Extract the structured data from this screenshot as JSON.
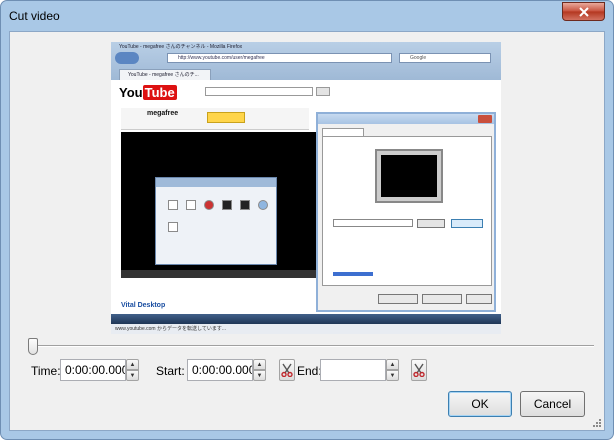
{
  "window": {
    "title": "Cut video"
  },
  "video_preview": {
    "browser_title": "YouTube - megafree さんのチャンネル - Mozilla Firefox",
    "url": "http://www.youtube.com/user/megafree",
    "search_placeholder": "Google",
    "tab_label": "YouTube - megafree さんのチ...",
    "logo_you": "You",
    "logo_tube": "Tube",
    "channel_name": "megafree",
    "video_title": "Vital Desktop",
    "status_text": "www.youtube.com からデータを転送しています..."
  },
  "controls": {
    "time_label": "Time:",
    "time_value": "0:00:00.000",
    "start_label": "Start:",
    "start_value": "0:00:00.000",
    "end_label": "End:",
    "end_value": ""
  },
  "buttons": {
    "ok_label": "OK",
    "cancel_label": "Cancel"
  }
}
